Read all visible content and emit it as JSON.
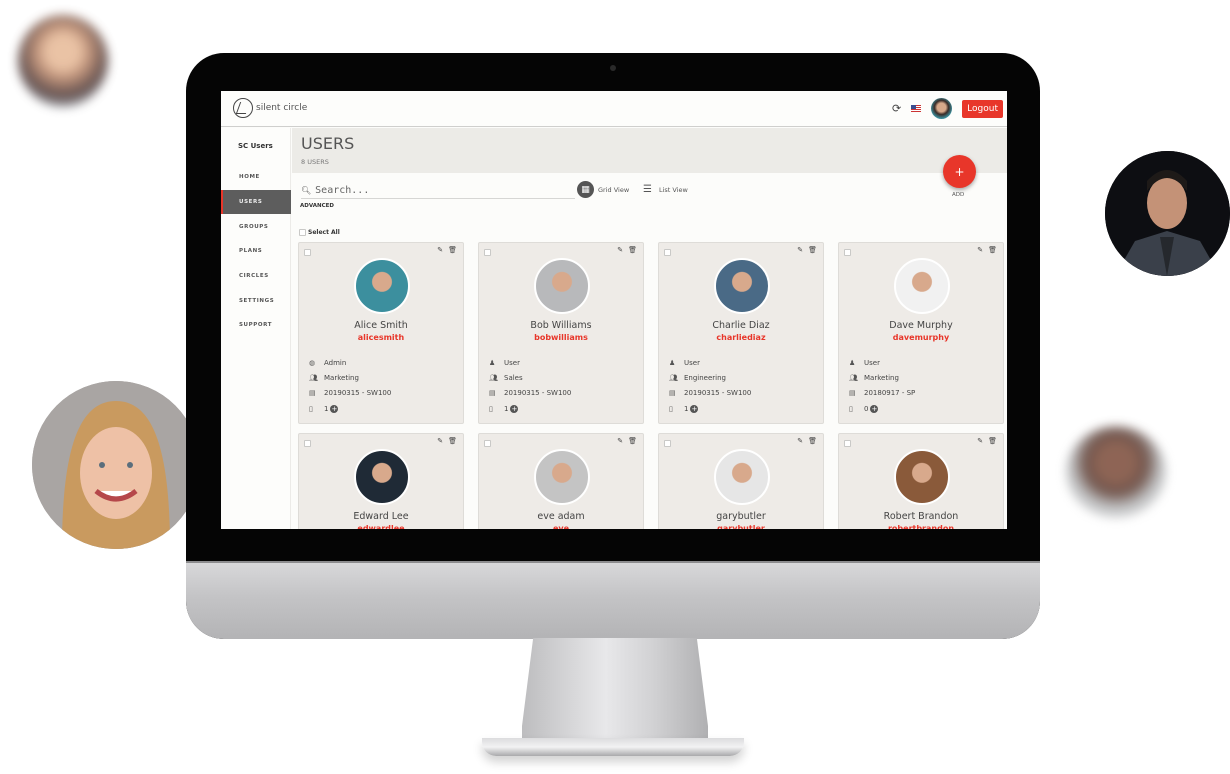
{
  "app": {
    "brand": "silent circle",
    "logout_label": "Logout",
    "refresh_icon": "refresh-icon",
    "flag": "us-flag-icon"
  },
  "sidebar": {
    "title": "SC Users",
    "items": [
      {
        "label": "HOME",
        "active": false
      },
      {
        "label": "USERS",
        "active": true
      },
      {
        "label": "GROUPS",
        "active": false
      },
      {
        "label": "PLANS",
        "active": false
      },
      {
        "label": "CIRCLES",
        "active": false
      },
      {
        "label": "SETTINGS",
        "active": false
      },
      {
        "label": "SUPPORT",
        "active": false
      }
    ]
  },
  "page": {
    "title": "USERS",
    "count_label": "8 USERS"
  },
  "toolbar": {
    "search_placeholder": "Search...",
    "search_value": "",
    "advanced_label": "ADVANCED",
    "grid_view_label": "Grid View",
    "list_view_label": "List View",
    "add_symbol": "+",
    "add_label": "ADD",
    "select_all_label": "Select All"
  },
  "colors": {
    "accent": "#e8362a",
    "card_bg": "#eeebe7",
    "header_band": "#ecebe7",
    "sidebar_active": "#5d5d5d"
  },
  "users": [
    {
      "name": "Alice Smith",
      "username": "alicesmith",
      "role": "Admin",
      "role_icon": "globe-icon",
      "group": "Marketing",
      "plan": "20190315 - SW100",
      "devices": "1",
      "avatar_color": "#3c8f9e"
    },
    {
      "name": "Bob Williams",
      "username": "bobwilliams",
      "role": "User",
      "role_icon": "user-icon",
      "group": "Sales",
      "plan": "20190315 - SW100",
      "devices": "1",
      "avatar_color": "#b8b9bb"
    },
    {
      "name": "Charlie Diaz",
      "username": "charliediaz",
      "role": "User",
      "role_icon": "user-icon",
      "group": "Engineering",
      "plan": "20190315 - SW100",
      "devices": "1",
      "avatar_color": "#4a6a86"
    },
    {
      "name": "Dave Murphy",
      "username": "davemurphy",
      "role": "User",
      "role_icon": "user-icon",
      "group": "Marketing",
      "plan": "20180917 - SP",
      "devices": "0",
      "avatar_color": "#f1f1f1"
    },
    {
      "name": "Edward Lee",
      "username": "edwardlee",
      "avatar_color": "#1f2a36"
    },
    {
      "name": "eve adam",
      "username": "eve",
      "avatar_color": "#c4c4c4"
    },
    {
      "name": "garybutler",
      "username": "garybutler",
      "avatar_color": "#e6e6e6"
    },
    {
      "name": "Robert Brandon",
      "username": "robertbrandon",
      "avatar_color": "#8a5a3a"
    }
  ]
}
